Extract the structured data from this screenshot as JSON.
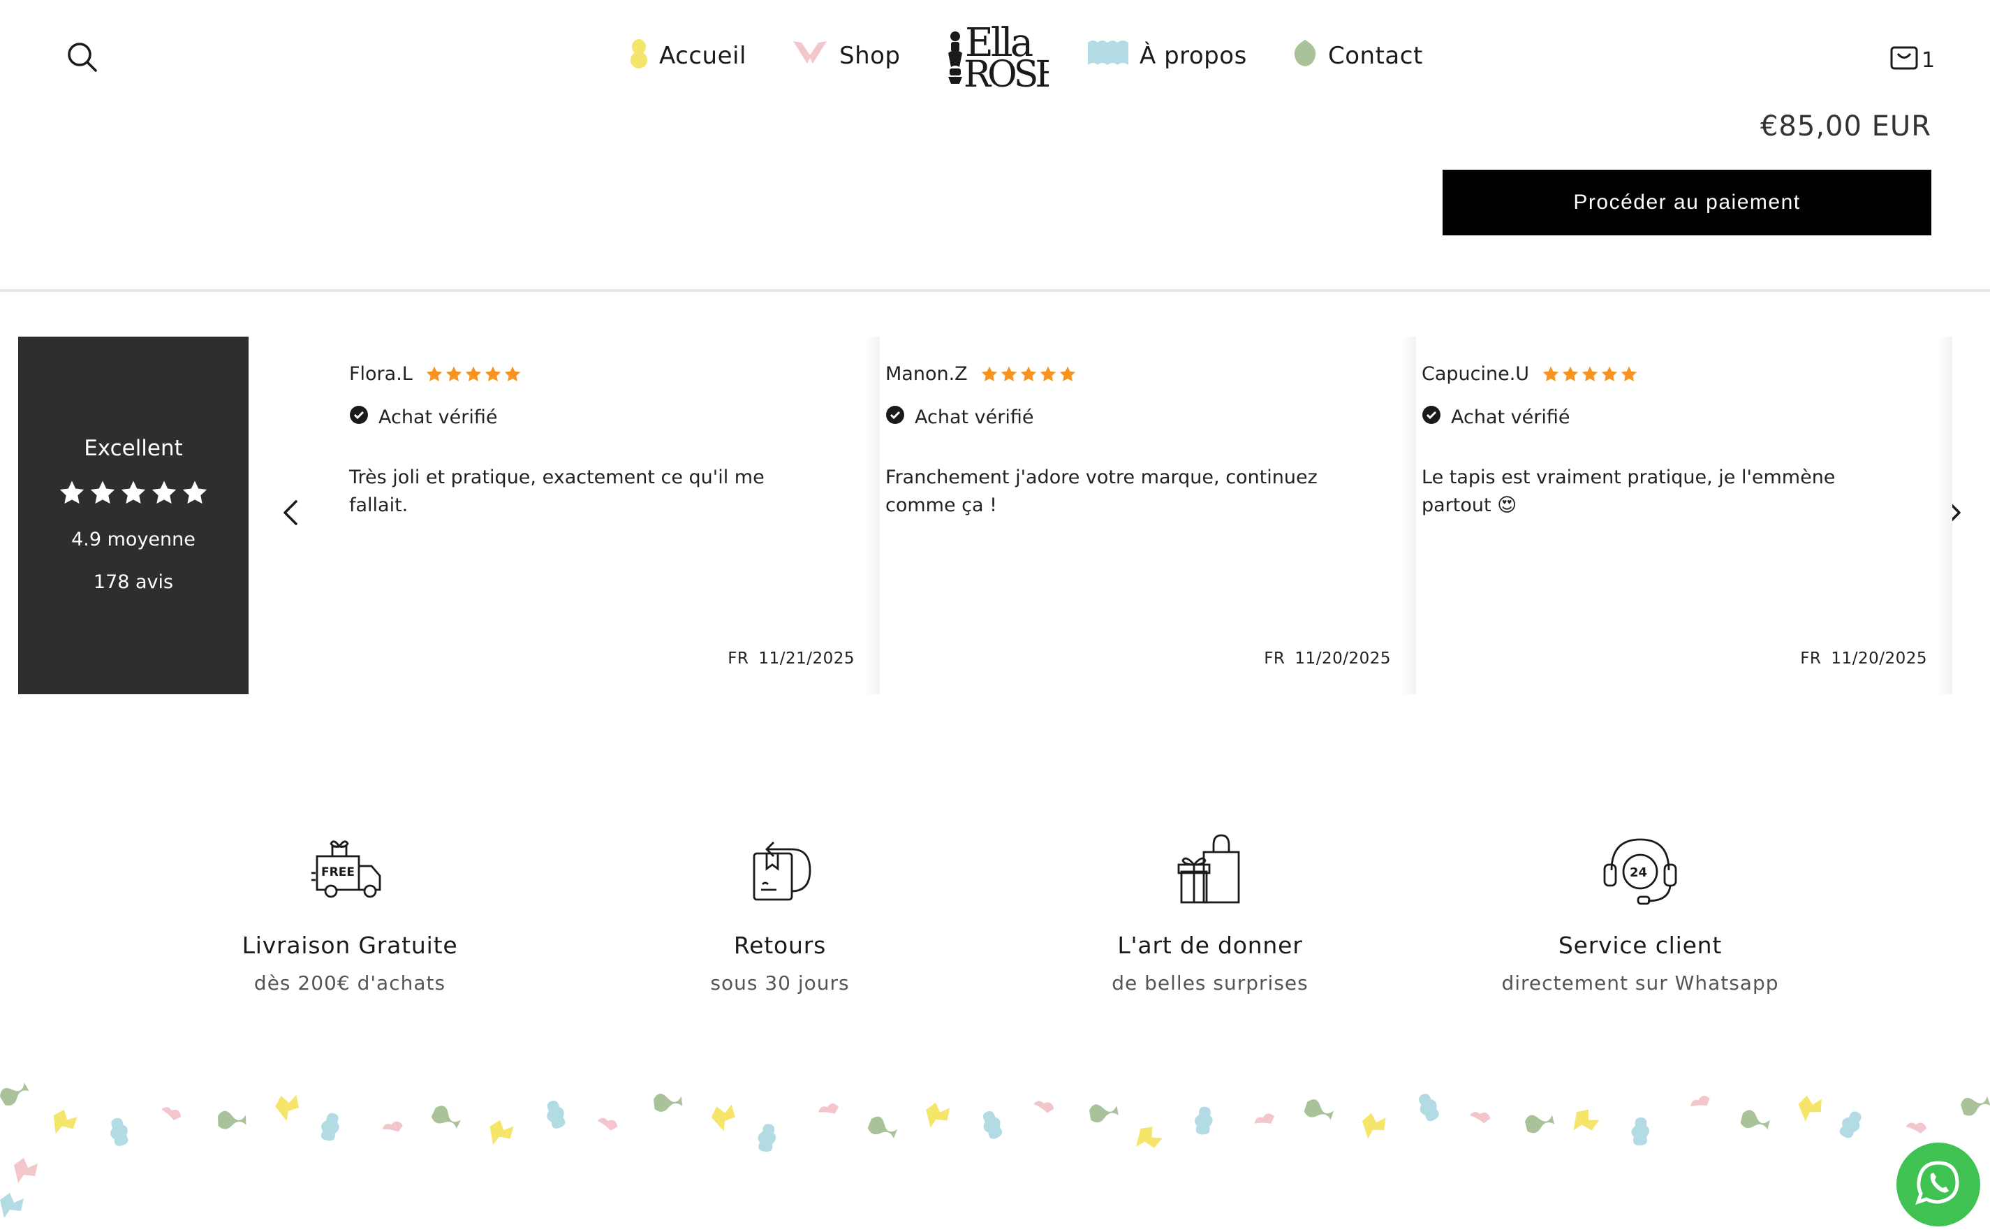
{
  "header": {
    "nav": [
      {
        "label": "Accueil",
        "icon": "yellow-blob-icon"
      },
      {
        "label": "Shop",
        "icon": "pink-bow-icon"
      },
      {
        "label": "À propos",
        "icon": "blue-wave-icon"
      },
      {
        "label": "Contact",
        "icon": "green-leaf-icon"
      }
    ],
    "logo_alt": "Ella Rose",
    "cart_count": "1"
  },
  "checkout": {
    "price": "€85,00 EUR",
    "pay_label": "Procéder au paiement"
  },
  "reviews_summary": {
    "rating_label": "Excellent",
    "average": "4.9 moyenne",
    "count": "178 avis",
    "stars": 5
  },
  "reviews": [
    {
      "name": "Flora.L",
      "stars": 5,
      "verified": "Achat vérifié",
      "text": "Très joli et pratique, exactement ce qu'il me fallait.",
      "country": "FR",
      "date": "11/21/2025"
    },
    {
      "name": "Manon.Z",
      "stars": 5,
      "verified": "Achat vérifié",
      "text": "Franchement j'adore votre marque, continuez comme ça !",
      "country": "FR",
      "date": "11/20/2025"
    },
    {
      "name": "Capucine.U",
      "stars": 5,
      "verified": "Achat vérifié",
      "text": "Le tapis est vraiment pratique, je l'emmène partout 😍",
      "country": "FR",
      "date": "11/20/2025"
    }
  ],
  "features": [
    {
      "title": "Livraison Gratuite",
      "subtitle": "dès 200€ d'achats",
      "icon": "free-delivery-truck-icon",
      "badge": "FREE"
    },
    {
      "title": "Retours",
      "subtitle": "sous 30 jours",
      "icon": "return-box-icon"
    },
    {
      "title": "L'art de donner",
      "subtitle": "de belles surprises",
      "icon": "gift-bag-icon"
    },
    {
      "title": "Service client",
      "subtitle": "directement sur Whatsapp",
      "icon": "headset-24-icon",
      "badge": "24"
    }
  ],
  "colors": {
    "star": "#f7931e",
    "button_bg": "#000000",
    "summary_bg": "#2e2e2e",
    "whatsapp": "#3fc251",
    "confetti_yellow": "#f5e56b",
    "confetti_pink": "#f3c6cc",
    "confetti_blue": "#b3dbe3",
    "confetti_green": "#aac29a"
  }
}
